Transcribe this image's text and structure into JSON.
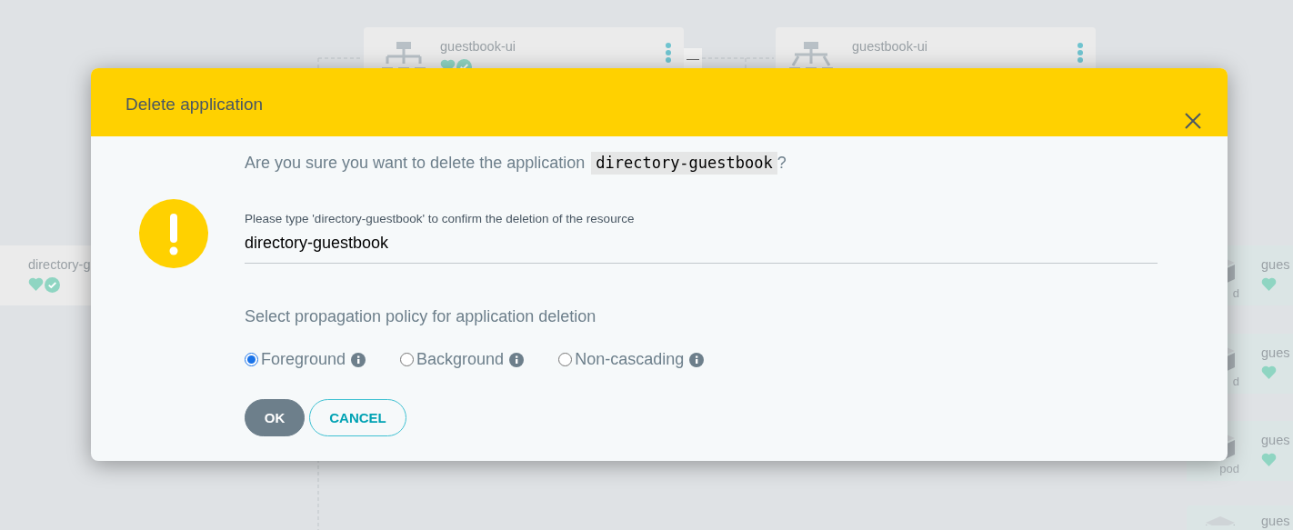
{
  "graph": {
    "nodes": [
      {
        "kind": "deployment",
        "name": "guestbook-ui",
        "badges": [
          {
            "kind": "health"
          },
          {
            "kind": "sync"
          }
        ]
      },
      {
        "kind": "service",
        "name": "guestbook-ui"
      },
      {
        "kind": "application",
        "name": "directory-g",
        "badges": [
          {
            "kind": "health"
          },
          {
            "kind": "sync"
          }
        ]
      },
      {
        "kind": "pod",
        "name": "gues",
        "type_label": "d",
        "badges": [
          {
            "kind": "health"
          }
        ]
      },
      {
        "kind": "pod",
        "name": "gues",
        "type_label": "d",
        "badges": [
          {
            "kind": "health"
          }
        ]
      },
      {
        "kind": "pod",
        "name": "gues",
        "type_label": "pod",
        "badges": [
          {
            "kind": "health"
          }
        ]
      },
      {
        "kind": "pod",
        "name": "gues"
      }
    ],
    "collapse_button": "—"
  },
  "dialog": {
    "title": "Delete application",
    "question": "Are you sure you want to delete the application",
    "app_name": "directory-guestbook",
    "question_end": "?",
    "confirm_label": "Please type 'directory-guestbook' to confirm the deletion of the resource",
    "confirm_value": "directory-guestbook",
    "policy_heading": "Select propagation policy for application deletion",
    "policies": [
      {
        "label": "Foreground",
        "selected": true
      },
      {
        "label": "Background",
        "selected": false
      },
      {
        "label": "Non-cascading",
        "selected": false
      }
    ],
    "buttons": [
      {
        "kind": "primary",
        "label": "OK"
      },
      {
        "kind": "secondary",
        "label": "CANCEL"
      }
    ]
  }
}
